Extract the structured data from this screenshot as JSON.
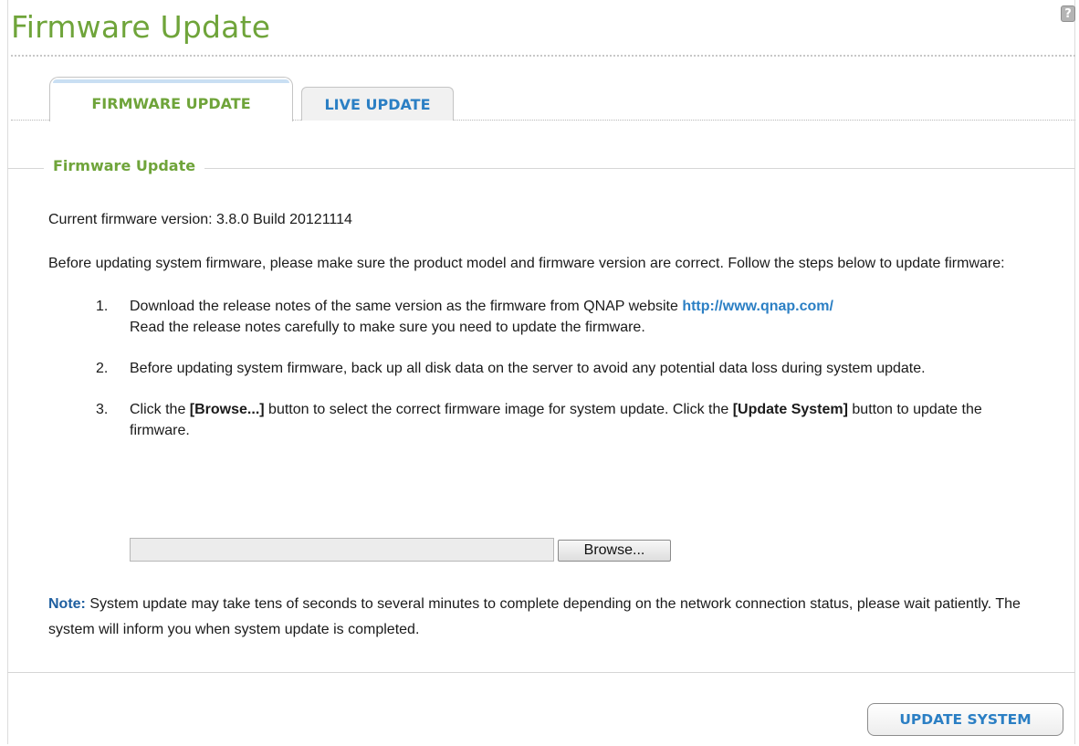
{
  "page": {
    "title": "Firmware Update",
    "help_icon_glyph": "?"
  },
  "tabs": [
    {
      "label": "FIRMWARE UPDATE",
      "active": true
    },
    {
      "label": "LIVE UPDATE",
      "active": false
    }
  ],
  "section": {
    "legend": "Firmware Update",
    "current_version": "Current firmware version: 3.8.0 Build 20121114",
    "intro": "Before updating system firmware, please make sure the product model and firmware version are correct. Follow the steps below to update firmware:",
    "steps": [
      {
        "num": "1.",
        "text_before": "Download the release notes of the same version as the firmware from QNAP website ",
        "link": "http://www.qnap.com/",
        "text_after": "Read the release notes carefully to make sure you need to update the firmware."
      },
      {
        "num": "2.",
        "text": "Before updating system firmware, back up all disk data on the server to avoid any potential data loss during system update."
      },
      {
        "num": "3.",
        "text_a": "Click the ",
        "bold_a": "[Browse...]",
        "text_b": " button to select the correct firmware image for system update. Click the ",
        "bold_b": "[Update System]",
        "text_c": " button to update the firmware."
      }
    ],
    "file_path_value": "",
    "browse_label": "Browse...",
    "note_label": "Note:",
    "note_text": " System update may take tens of seconds to several minutes to complete depending on the network connection status, please wait patiently. The system will inform you when system update is completed."
  },
  "footer": {
    "update_button_label": "UPDATE SYSTEM"
  },
  "colors": {
    "accent_green": "#6fa43a",
    "link_blue": "#2b7fc4",
    "note_blue": "#1f5fa0"
  },
  "icons": {
    "help": "help-icon"
  }
}
